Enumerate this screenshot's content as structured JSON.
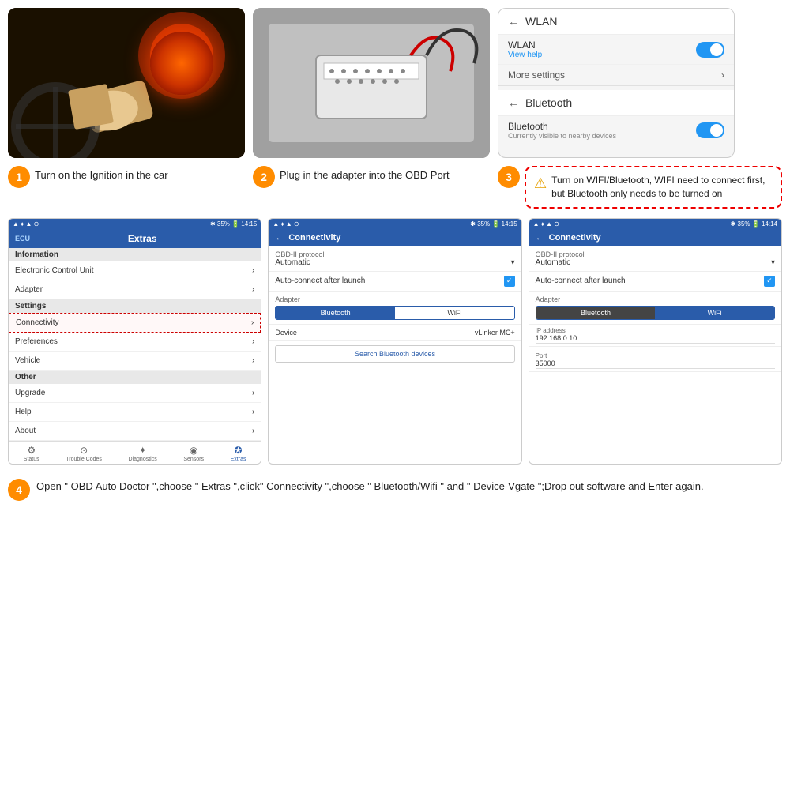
{
  "steps": {
    "step1": {
      "number": "1",
      "text": "Turn on the Ignition in the car"
    },
    "step2": {
      "number": "2",
      "text": "Plug in the adapter into the OBD Port"
    },
    "step3": {
      "number": "3",
      "warning": "Turn on WIFI/Bluetooth, WIFI need to connect first, but Bluetooth only needs to be turned on"
    },
    "step4": {
      "number": "4",
      "text": "Open \" OBD Auto Doctor \",choose \" Extras \",click\" Connectivity \",choose \" Bluetooth/Wifi \" and \" Device-Vgate \";Drop out software and Enter again."
    }
  },
  "wlan_screen": {
    "back": "←",
    "title": "WLAN",
    "wlan_label": "WLAN",
    "view_help": "View help",
    "more_settings": "More settings",
    "bt_title": "Bluetooth",
    "bt_label": "Bluetooth",
    "bt_sub": "Currently visible to nearby devices"
  },
  "extras_screen": {
    "ecu": "ECU",
    "title": "Extras",
    "info_section": "Information",
    "ecu_item": "Electronic Control Unit",
    "adapter_item": "Adapter",
    "settings_section": "Settings",
    "connectivity_item": "Connectivity",
    "preferences_item": "Preferences",
    "vehicle_item": "Vehicle",
    "other_section": "Other",
    "upgrade_item": "Upgrade",
    "help_item": "Help",
    "about_item": "About",
    "nav": {
      "status": "Status",
      "trouble": "Trouble Codes",
      "diagnostics": "Diagnostics",
      "sensors": "Sensors",
      "extras": "Extras"
    }
  },
  "connectivity_bt_screen": {
    "back": "←",
    "title": "Connectivity",
    "obd_protocol_label": "OBD-II protocol",
    "obd_protocol_value": "Automatic",
    "auto_connect_label": "Auto-connect after launch",
    "adapter_label": "Adapter",
    "tab_bluetooth": "Bluetooth",
    "tab_wifi": "WiFi",
    "device_label": "Device",
    "device_value": "vLinker MC+",
    "search_btn": "Search Bluetooth devices"
  },
  "connectivity_wifi_screen": {
    "back": "←",
    "title": "Connectivity",
    "obd_protocol_label": "OBD-II protocol",
    "obd_protocol_value": "Automatic",
    "auto_connect_label": "Auto-connect after launch",
    "adapter_label": "Adapter",
    "tab_bluetooth": "Bluetooth",
    "tab_wifi": "WiFi",
    "ip_label": "IP address",
    "ip_value": "192.168.0.10",
    "port_label": "Port",
    "port_value": "35000"
  },
  "status_bar": {
    "signal": "▲ 35%",
    "battery": "14:15",
    "icons": "* ⊟ ⊙"
  }
}
